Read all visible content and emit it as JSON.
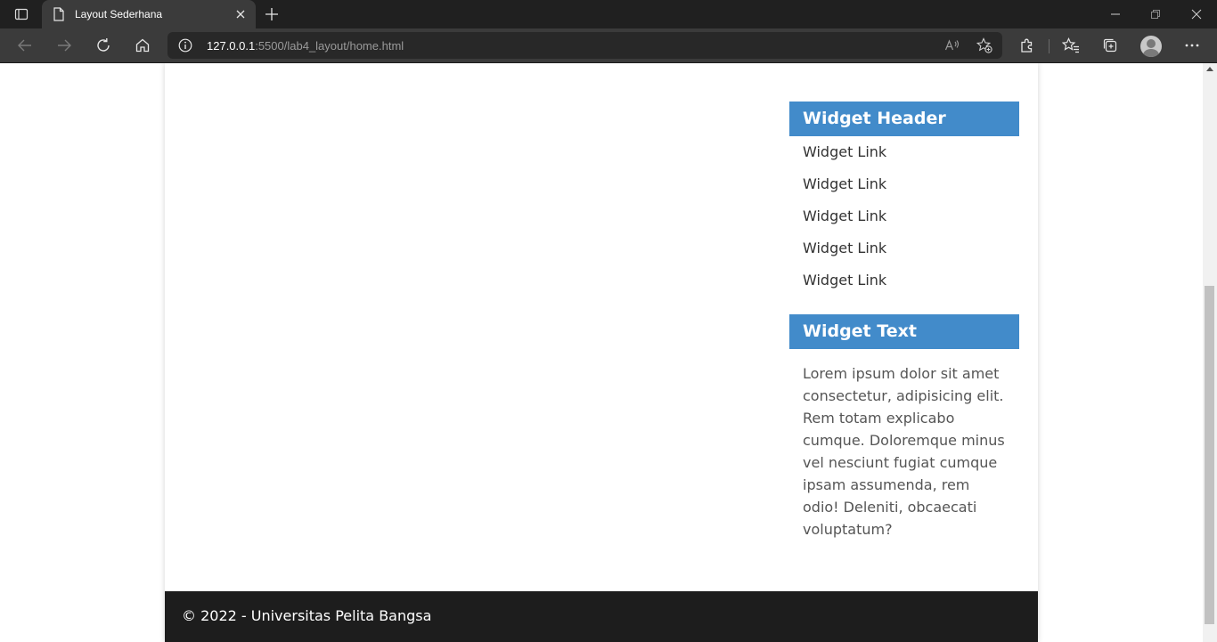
{
  "browser": {
    "tab_title": "Layout Sederhana",
    "url_host": "127.0.0.1",
    "url_rest": ":5500/lab4_layout/home.html",
    "icons": [
      "tab-actions-icon",
      "document-icon",
      "close-icon",
      "plus-icon",
      "minimize-icon",
      "restore-icon",
      "window-close-icon",
      "back-icon",
      "forward-icon",
      "refresh-icon",
      "home-icon",
      "info-icon",
      "read-aloud-icon",
      "add-favorite-icon",
      "extensions-icon",
      "favorites-icon",
      "collections-icon",
      "profile-avatar",
      "more-icon"
    ]
  },
  "sidebar": {
    "links_header": "Widget Header",
    "links": [
      "Widget Link",
      "Widget Link",
      "Widget Link",
      "Widget Link",
      "Widget Link"
    ],
    "text_header": "Widget Text",
    "text_body": "Lorem ipsum dolor sit amet consectetur, adipisicing elit. Rem totam explicabo cumque. Doloremque minus vel nesciunt fugiat cumque ipsam assumenda, rem odio! Deleniti, obcaecati voluptatum?"
  },
  "footer": {
    "text": "© 2022 - Universitas Pelita Bangsa"
  },
  "colors": {
    "widget_header_bg": "#428bca",
    "footer_bg": "#1d1d1d",
    "chrome_dark": "#202020",
    "chrome_toolbar": "#3b3b3b"
  }
}
